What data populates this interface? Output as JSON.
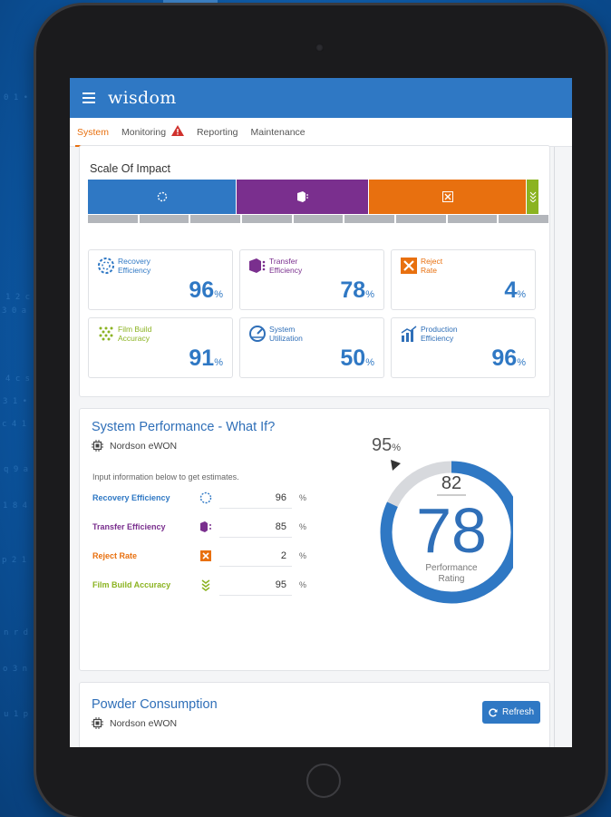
{
  "app": {
    "logo": "wisdom"
  },
  "tabs": [
    {
      "label": "System",
      "active": true
    },
    {
      "label": "Monitoring",
      "alert": true
    },
    {
      "label": "Reporting"
    },
    {
      "label": "Maintenance"
    }
  ],
  "scale_of_impact": {
    "title": "Scale Of Impact",
    "segments": [
      {
        "name": "recovery",
        "color": "#2f78c4",
        "icon": "recovery-icon"
      },
      {
        "name": "transfer",
        "color": "#7a2f8e",
        "icon": "transfer-icon"
      },
      {
        "name": "reject",
        "color": "#e8700f",
        "icon": "reject-icon"
      },
      {
        "name": "film",
        "color": "#8bb321",
        "icon": "film-icon"
      }
    ],
    "metrics": [
      {
        "label_1": "Recovery",
        "label_2": "Efficiency",
        "value": "96",
        "unit": "%",
        "color": "#2f78c4",
        "icon": "recovery-icon"
      },
      {
        "label_1": "Transfer",
        "label_2": "Efficiency",
        "value": "78",
        "unit": "%",
        "color": "#7a2f8e",
        "icon": "transfer-icon"
      },
      {
        "label_1": "Reject",
        "label_2": "Rate",
        "value": "4",
        "unit": "%",
        "color": "#e8700f",
        "icon": "reject-icon"
      },
      {
        "label_1": "Film Build",
        "label_2": "Accuracy",
        "value": "91",
        "unit": "%",
        "color": "#8bb321",
        "icon": "film-icon"
      },
      {
        "label_1": "System",
        "label_2": "Utilization",
        "value": "50",
        "unit": "%",
        "color": "#2f6fb8",
        "icon": "gauge-icon"
      },
      {
        "label_1": "Production",
        "label_2": "Efficiency",
        "value": "96",
        "unit": "%",
        "color": "#2f6fb8",
        "icon": "chart-icon"
      }
    ]
  },
  "performance": {
    "title": "System Performance - What If?",
    "device": "Nordson eWON",
    "hint": "Input information below to get estimates.",
    "inputs": [
      {
        "label": "Recovery Efficiency",
        "value": "96",
        "unit": "%",
        "color": "#2f78c4",
        "icon": "recovery-icon"
      },
      {
        "label": "Transfer Efficiency",
        "value": "85",
        "unit": "%",
        "color": "#7a2f8e",
        "icon": "transfer-icon"
      },
      {
        "label": "Reject Rate",
        "value": "2",
        "unit": "%",
        "color": "#e8700f",
        "icon": "reject-icon"
      },
      {
        "label": "Film Build Accuracy",
        "value": "95",
        "unit": "%",
        "color": "#8bb321",
        "icon": "film-icon"
      }
    ],
    "gauge": {
      "target": "95",
      "target_unit": "%",
      "estimate": "82",
      "rating": "78",
      "rating_label_1": "Performance",
      "rating_label_2": "Rating",
      "fill_percent": 82,
      "track_color": "#d7d9dd",
      "fill_color": "#2f78c4"
    }
  },
  "powder": {
    "title": "Powder Consumption",
    "device": "Nordson eWON",
    "refresh_label": "Refresh"
  }
}
